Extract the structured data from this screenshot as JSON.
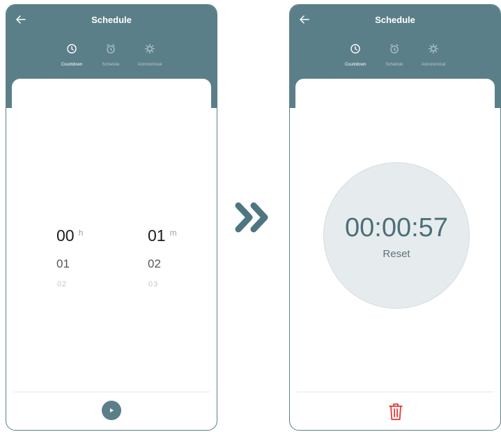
{
  "arrow_icon": "double-chevron-right-icon",
  "accent_color": "#5b7f89",
  "left_screen": {
    "title": "Schedule",
    "tabs": [
      {
        "label": "Countdown",
        "icon": "clock-icon",
        "active": true
      },
      {
        "label": "Schedule",
        "icon": "alarm-icon",
        "active": false
      },
      {
        "label": "Astronomical",
        "icon": "sun-icon",
        "active": false
      }
    ],
    "picker": {
      "hours_selected": "00",
      "hours_unit": "h",
      "hours_next": "01",
      "hours_next2": "02",
      "minutes_selected": "01",
      "minutes_unit": "m",
      "minutes_next": "02",
      "minutes_next2": "03"
    },
    "play_icon": "play-icon"
  },
  "right_screen": {
    "title": "Schedule",
    "tabs": [
      {
        "label": "Countdown",
        "icon": "clock-icon",
        "active": true
      },
      {
        "label": "Schedule",
        "icon": "alarm-icon",
        "active": false
      },
      {
        "label": "Astronomical",
        "icon": "sun-icon",
        "active": false
      }
    ],
    "timer": "00:00:57",
    "reset_label": "Reset",
    "delete_icon": "trash-icon",
    "delete_color": "#e53935"
  }
}
